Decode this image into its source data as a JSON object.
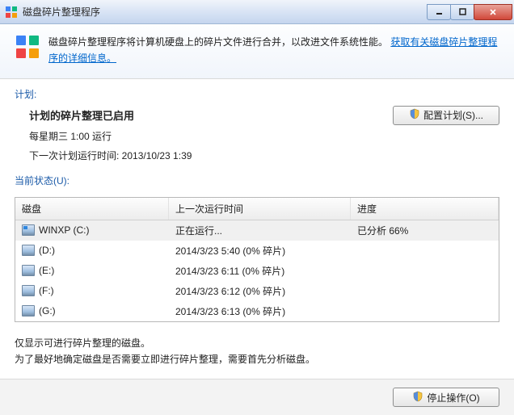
{
  "window": {
    "title": "磁盘碎片整理程序"
  },
  "banner": {
    "text": "磁盘碎片整理程序将计算机硬盘上的碎片文件进行合并，以改进文件系统性能。",
    "link": "获取有关磁盘碎片整理程序的详细信息。"
  },
  "schedule": {
    "section_label": "计划:",
    "title": "计划的碎片整理已启用",
    "line1": "每星期三  1:00 运行",
    "line2": "下一次计划运行时间: 2013/10/23 1:39",
    "config_btn": "配置计划(S)..."
  },
  "status": {
    "section_label": "当前状态(U):",
    "headers": {
      "disk": "磁盘",
      "last": "上一次运行时间",
      "progress": "进度"
    },
    "rows": [
      {
        "name": "WINXP (C:)",
        "last": "正在运行...",
        "progress": "已分析 66%",
        "win": true,
        "selected": true
      },
      {
        "name": "(D:)",
        "last": "2014/3/23 5:40 (0% 碎片)",
        "progress": "",
        "win": false,
        "selected": false
      },
      {
        "name": "(E:)",
        "last": "2014/3/23 6:11 (0% 碎片)",
        "progress": "",
        "win": false,
        "selected": false
      },
      {
        "name": "(F:)",
        "last": "2014/3/23 6:12 (0% 碎片)",
        "progress": "",
        "win": false,
        "selected": false
      },
      {
        "name": "(G:)",
        "last": "2014/3/23 6:13 (0% 碎片)",
        "progress": "",
        "win": false,
        "selected": false
      }
    ]
  },
  "footer": {
    "line1": "仅显示可进行碎片整理的磁盘。",
    "line2": "为了最好地确定磁盘是否需要立即进行碎片整理，需要首先分析磁盘。"
  },
  "actions": {
    "stop": "停止操作(O)"
  }
}
